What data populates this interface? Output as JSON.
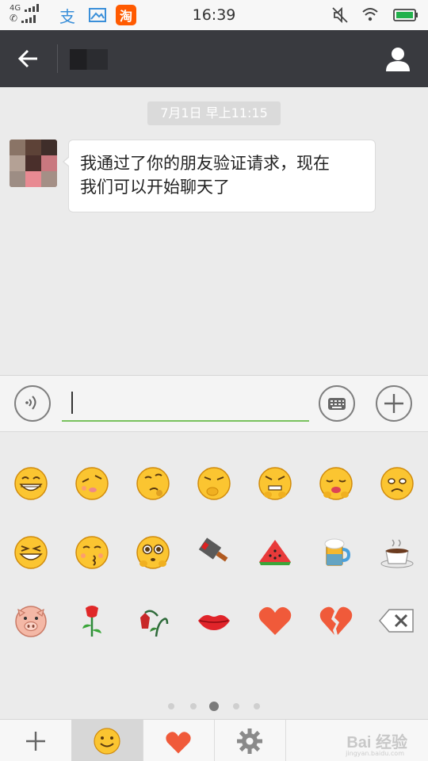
{
  "status_bar": {
    "network_label": "4G",
    "time": "16:39",
    "taobao_label": "淘",
    "zhifubao_label": "支"
  },
  "header": {
    "contact_name": "",
    "back_icon": "arrow-left-icon",
    "profile_icon": "person-icon"
  },
  "chat": {
    "timestamp": "7月1日 早上11:15",
    "messages": [
      {
        "sender": "contact",
        "text_line1": "我通过了你的朋友验证请求，现在",
        "text_line2": "我们可以开始聊天了"
      }
    ]
  },
  "input_bar": {
    "value": "",
    "voice_icon": "voice-icon",
    "keyboard_icon": "keyboard-icon",
    "plus_icon": "plus-icon"
  },
  "emoji_panel": {
    "rows": [
      [
        "grin-face",
        "sleepy-face",
        "thinking-face",
        "shush-face",
        "grumpy-face",
        "bored-face",
        "sad-face"
      ],
      [
        "squint-grin-face",
        "kiss-face",
        "teary-face",
        "cleaver",
        "watermelon",
        "beer",
        "coffee"
      ],
      [
        "pig-face",
        "rose",
        "wilted-rose",
        "lips",
        "heart",
        "broken-heart",
        "backspace"
      ]
    ],
    "page_count": 5,
    "active_page": 3
  },
  "bottom_bar": {
    "tabs": [
      "plus",
      "smiley",
      "heart",
      "settings"
    ],
    "active_tab": 1,
    "watermark": "Bai 经验",
    "watermark_sub": "jingyan.baidu.com"
  },
  "colors": {
    "header_bg": "#393a3f",
    "accent_green": "#79c25e",
    "heart_red": "#f05a3a",
    "emoji_yellow": "#fbc531"
  }
}
